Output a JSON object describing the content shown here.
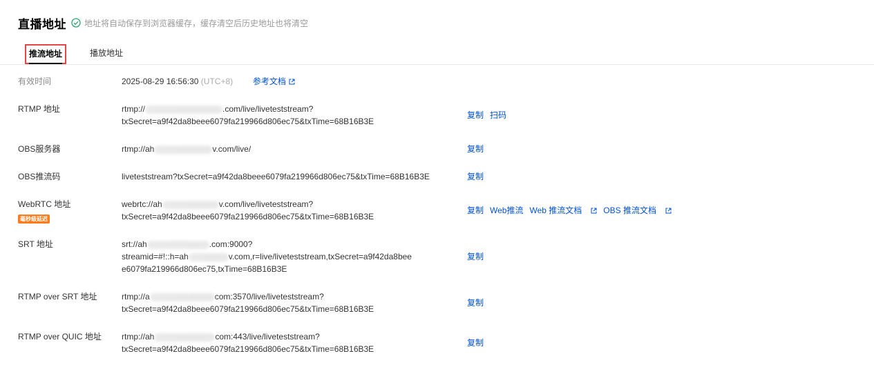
{
  "header": {
    "title": "直播地址",
    "hint": "地址将自动保存到浏览器缓存，缓存清空后历史地址也将清空"
  },
  "tabs": [
    {
      "label": "推流地址",
      "active": true
    },
    {
      "label": "播放地址",
      "active": false
    }
  ],
  "validity": {
    "label": "有效时间",
    "datetime": "2025-08-29 16:56:30",
    "timezone": "(UTC+8)",
    "doc_link": "参考文档"
  },
  "rows": {
    "rtmp": {
      "label": "RTMP 地址",
      "line1_a": "rtmp://",
      "line1_b": ".com/live/liveteststream?",
      "line2": "txSecret=a9f42da8beee6079fa219966d806ec75&txTime=68B16B3E",
      "copy": "复制",
      "scan": "扫码"
    },
    "obs_server": {
      "label": "OBS服务器",
      "line1_a": "rtmp://ah",
      "line1_b": "v.com/live/",
      "copy": "复制"
    },
    "obs_key": {
      "label": "OBS推流码",
      "line1": "liveteststream?txSecret=a9f42da8beee6079fa219966d806ec75&txTime=68B16B3E",
      "copy": "复制"
    },
    "webrtc": {
      "label": "WebRTC 地址",
      "badge": "毫秒级延迟",
      "line1_a": "webrtc://ah",
      "line1_b": "v.com/live/liveteststream?",
      "line2": "txSecret=a9f42da8beee6079fa219966d806ec75&txTime=68B16B3E",
      "copy": "复制",
      "web_push": "Web推流",
      "web_doc": "Web 推流文档",
      "obs_doc": "OBS 推流文档"
    },
    "srt": {
      "label": "SRT 地址",
      "line1_a": "srt://ah",
      "line1_b": ".com:9000?",
      "line2_a": "streamid=#!::h=ah",
      "line2_b": "v.com,r=live/liveteststream,txSecret=a9f42da8bee",
      "line3": "e6079fa219966d806ec75,txTime=68B16B3E",
      "copy": "复制"
    },
    "rtmp_srt": {
      "label": "RTMP over SRT 地址",
      "line1_a": "rtmp://a",
      "line1_b": "com:3570/live/liveteststream?",
      "line2": "txSecret=a9f42da8beee6079fa219966d806ec75&txTime=68B16B3E",
      "copy": "复制"
    },
    "rtmp_quic": {
      "label": "RTMP over QUIC 地址",
      "line1_a": "rtmp://ah",
      "line1_b": "com:443/live/liveteststream?",
      "line2": "txSecret=a9f42da8beee6079fa219966d806ec75&txTime=68B16B3E",
      "copy": "复制"
    }
  },
  "colors": {
    "accent": "#0052d9",
    "success": "#2ba471",
    "badge": "#ff7b1b",
    "tab_outline": "#e54545"
  }
}
